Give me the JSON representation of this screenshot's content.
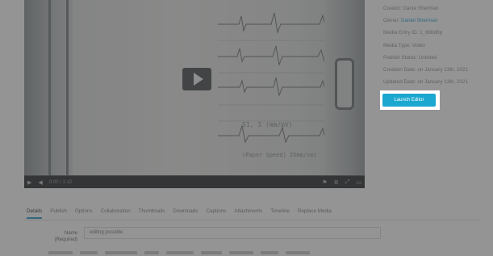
{
  "metadata": {
    "creator": "Creator: Dante Sherman",
    "owner_label": "Owner: ",
    "owner_value": "Daniel Sherman",
    "entry_id": "Media Entry ID: 1_66bd0p",
    "media_type": "Media Type: Video",
    "publish_status": "Publish Status: Unlisted",
    "creation_date": "Creation Date: on January 13th, 2021",
    "updated_date": "Updated Date: on January 13th, 2021"
  },
  "launch_editor": "Launch Editor",
  "player": {
    "time": "0:00 / 1:12",
    "ecg_annotation": "S1, 3 (mm/mV)",
    "ecg_annotation2": "(Paper Speed)  25mm/sec"
  },
  "tabs": [
    {
      "label": "Details"
    },
    {
      "label": "Publish"
    },
    {
      "label": "Options"
    },
    {
      "label": "Collaboration"
    },
    {
      "label": "Thumbnails"
    },
    {
      "label": "Downloads"
    },
    {
      "label": "Captions"
    },
    {
      "label": "Attachments"
    },
    {
      "label": "Timeline"
    },
    {
      "label": "Replace Media"
    }
  ],
  "form": {
    "name_label": "Name (Required)",
    "name_value": "editing possible"
  },
  "colors": {
    "accent": "#1ba7cf",
    "link": "#2a9ecf",
    "overlay": "#3c3c3c"
  }
}
